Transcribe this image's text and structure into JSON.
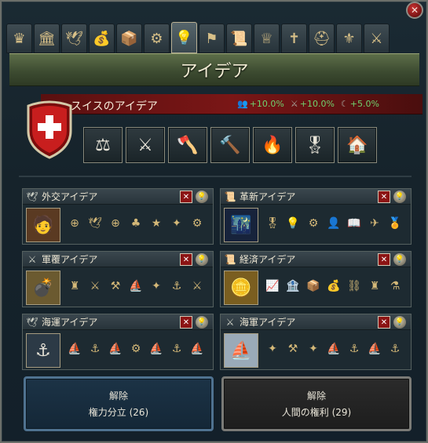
{
  "window": {
    "title": "アイデア"
  },
  "tabs": [
    {
      "icon": "crown-icon",
      "glyph": "♛"
    },
    {
      "icon": "court-building-icon",
      "glyph": "🏛"
    },
    {
      "icon": "dove-icon",
      "glyph": "🕊"
    },
    {
      "icon": "money-bag-icon",
      "glyph": "💰"
    },
    {
      "icon": "trade-crates-icon",
      "glyph": "📦"
    },
    {
      "icon": "gears-icon",
      "glyph": "⚙"
    },
    {
      "icon": "lightbulb-icon",
      "glyph": "💡"
    },
    {
      "icon": "flag-icon",
      "glyph": "⚑"
    },
    {
      "icon": "scroll-icon",
      "glyph": "📜"
    },
    {
      "icon": "royal-crown-icon",
      "glyph": "♕"
    },
    {
      "icon": "cross-icon",
      "glyph": "✝"
    },
    {
      "icon": "helmet-icon",
      "glyph": "⛑"
    },
    {
      "icon": "crest-icon",
      "glyph": "⚜"
    },
    {
      "icon": "swords-icon",
      "glyph": "⚔"
    }
  ],
  "country": {
    "name": "スイスのアイデア",
    "modifiers": [
      {
        "icon": "manpower-icon",
        "value": "+10.0%"
      },
      {
        "icon": "discipline-icon",
        "value": "+10.0%"
      },
      {
        "icon": "morale-icon",
        "value": "+5.0%"
      }
    ],
    "national_ideas": [
      {
        "icon": "scales-icon",
        "glyph": "⚖"
      },
      {
        "icon": "mercenary-icon",
        "glyph": "⚔"
      },
      {
        "icon": "axes-icon",
        "glyph": "🪓"
      },
      {
        "icon": "hammer-coins-icon",
        "glyph": "🔨"
      },
      {
        "icon": "torch-icon",
        "glyph": "🔥"
      },
      {
        "icon": "medal-icon",
        "glyph": "🎖"
      },
      {
        "icon": "building-growth-icon",
        "glyph": "🏠"
      }
    ]
  },
  "groups": [
    {
      "title": "外交アイデア",
      "cat": "🕊",
      "portrait": "🧑",
      "icons": [
        "⊕",
        "🕊",
        "⊕",
        "♣",
        "★",
        "✦",
        "⚙"
      ]
    },
    {
      "title": "革新アイデア",
      "cat": "📜",
      "portrait": "🌃",
      "icons": [
        "🎖",
        "💡",
        "⚙",
        "👤",
        "📖",
        "✈",
        "🏅"
      ]
    },
    {
      "title": "軍覆アイデア",
      "cat": "⚔",
      "portrait": "💣",
      "icons": [
        "♜",
        "⚔",
        "⚒",
        "⛵",
        "✦",
        "⚓",
        "⚔"
      ]
    },
    {
      "title": "経済アイデア",
      "cat": "📜",
      "portrait": "🪙",
      "icons": [
        "📈",
        "🏦",
        "📦",
        "💰",
        "⛓",
        "♜",
        "⚗"
      ]
    },
    {
      "title": "海運アイデア",
      "cat": "🕊",
      "portrait": "⚓",
      "icons": [
        "⛵",
        "⚓",
        "⛵",
        "⚙",
        "⛵",
        "⚓",
        "⛵"
      ]
    },
    {
      "title": "海軍アイデア",
      "cat": "⚔",
      "portrait": "⛵",
      "icons": [
        "✦",
        "⚒",
        "✦",
        "⛵",
        "⚓",
        "⛵",
        "⚓"
      ]
    }
  ],
  "policies": [
    {
      "line1": "解除",
      "line2": "権力分立 (26)"
    },
    {
      "line1": "解除",
      "line2": "人間の権利 (29)"
    }
  ]
}
